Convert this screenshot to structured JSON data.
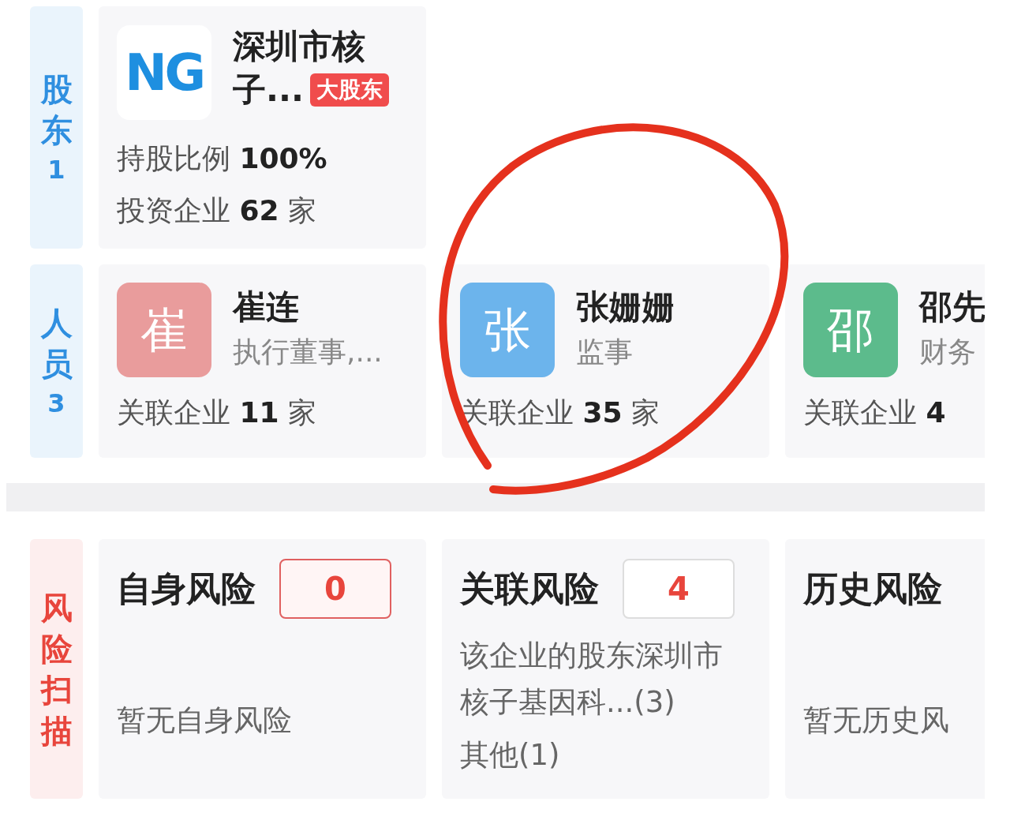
{
  "shareholders": {
    "label_chars": [
      "股",
      "东"
    ],
    "count": "1",
    "items": [
      {
        "logo_text": "NG",
        "name_lines": [
          "深圳市核",
          "子..."
        ],
        "badge": "大股东",
        "stats": [
          {
            "label": "持股比例",
            "value": "100%"
          },
          {
            "label": "投资企业",
            "value": "62",
            "unit": "家"
          }
        ]
      }
    ]
  },
  "people": {
    "label_chars": [
      "人",
      "员"
    ],
    "count": "3",
    "items": [
      {
        "avatar": "崔",
        "color": "#e99c9c",
        "name": "崔连",
        "role": "执行董事,...",
        "related": {
          "label": "关联企业",
          "value": "11",
          "unit": "家"
        }
      },
      {
        "avatar": "张",
        "color": "#6cb4ec",
        "name": "张姗姗",
        "role": "监事",
        "related": {
          "label": "关联企业",
          "value": "35",
          "unit": "家"
        }
      },
      {
        "avatar": "邵",
        "color": "#5cbb8c",
        "name": "邵先",
        "role": "财务",
        "related": {
          "label": "关联企业",
          "value": "4"
        }
      }
    ]
  },
  "risk_scan": {
    "label_chars": [
      "风",
      "险",
      "扫",
      "描"
    ],
    "items": [
      {
        "title": "自身风险",
        "count": "0",
        "highlighted": true,
        "lines": [
          "暂无自身风险"
        ]
      },
      {
        "title": "关联风险",
        "count": "4",
        "highlighted": false,
        "lines": [
          "该企业的股东深圳市核子基因科...(3)",
          "其他(1)"
        ]
      },
      {
        "title": "历史风险",
        "lines": [
          "暂无历史风"
        ]
      }
    ]
  },
  "annotation": {
    "kind": "circle",
    "color": "#e5311d"
  }
}
